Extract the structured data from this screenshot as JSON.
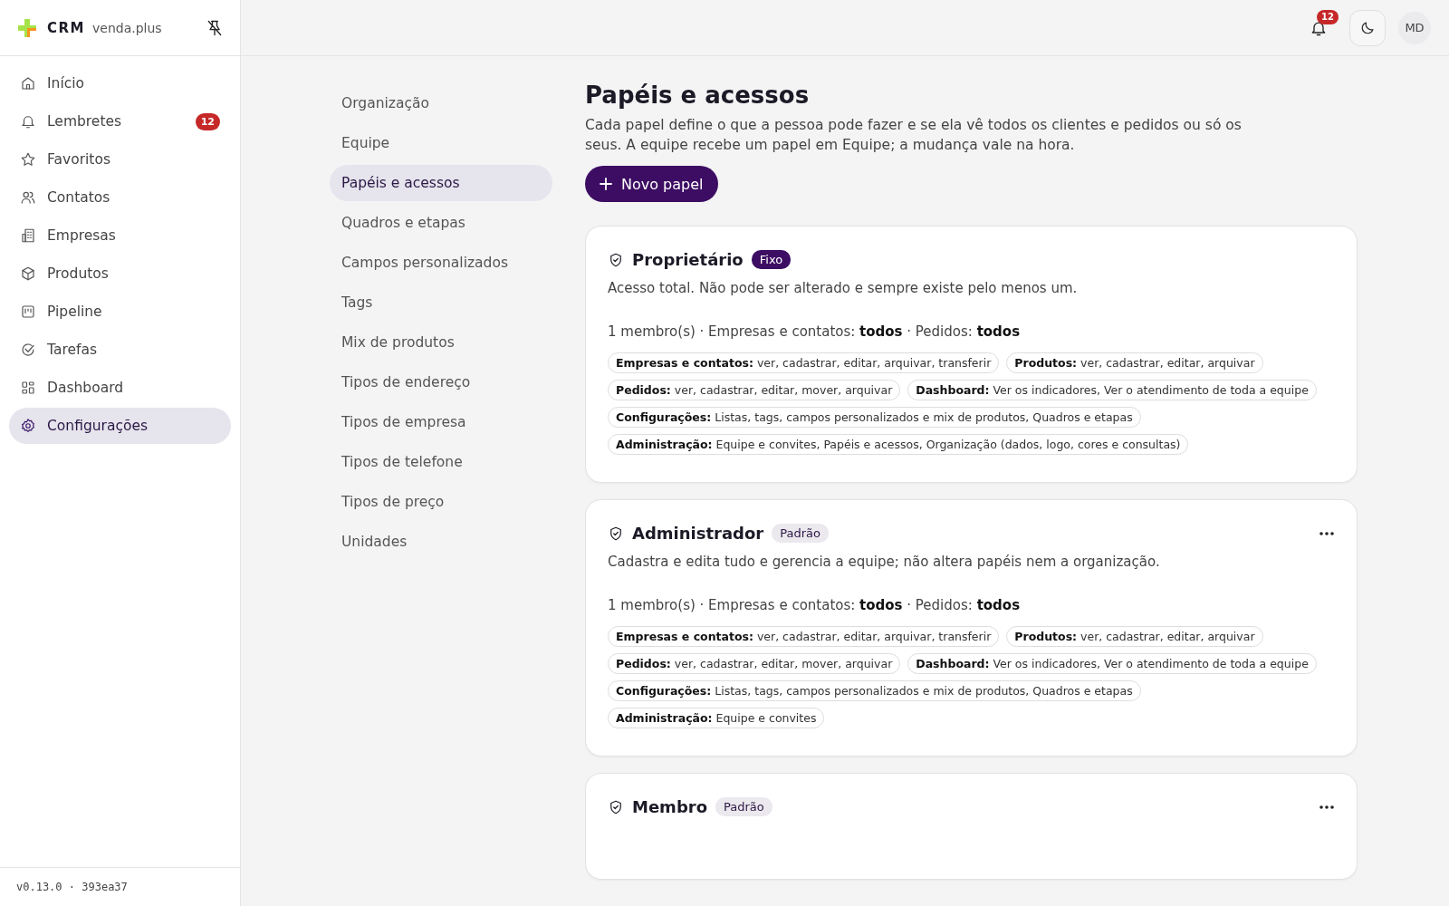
{
  "brand": {
    "name": "CRM",
    "domain": "venda.plus"
  },
  "sidebar": {
    "items": [
      {
        "label": "Início",
        "selected": false
      },
      {
        "label": "Lembretes",
        "selected": false,
        "badge": "12"
      },
      {
        "label": "Favoritos",
        "selected": false
      },
      {
        "label": "Contatos",
        "selected": false
      },
      {
        "label": "Empresas",
        "selected": false
      },
      {
        "label": "Produtos",
        "selected": false
      },
      {
        "label": "Pipeline",
        "selected": false
      },
      {
        "label": "Tarefas",
        "selected": false
      },
      {
        "label": "Dashboard",
        "selected": false
      },
      {
        "label": "Configurações",
        "selected": true
      }
    ],
    "version": "v0.13.0 · 393ea37"
  },
  "topbar": {
    "notifications": "12",
    "avatar": "MD"
  },
  "settings_nav": [
    {
      "label": "Organização",
      "selected": false
    },
    {
      "label": "Equipe",
      "selected": false
    },
    {
      "label": "Papéis e acessos",
      "selected": true
    },
    {
      "label": "Quadros e etapas",
      "selected": false
    },
    {
      "label": "Campos personalizados",
      "selected": false
    },
    {
      "label": "Tags",
      "selected": false
    },
    {
      "label": "Mix de produtos",
      "selected": false
    },
    {
      "label": "Tipos de endereço",
      "selected": false
    },
    {
      "label": "Tipos de empresa",
      "selected": false
    },
    {
      "label": "Tipos de telefone",
      "selected": false
    },
    {
      "label": "Tipos de preço",
      "selected": false
    },
    {
      "label": "Unidades",
      "selected": false
    }
  ],
  "page": {
    "title": "Papéis e acessos",
    "description": "Cada papel define o que a pessoa pode fazer e se ela vê todos os clientes e pedidos ou só os seus. A equipe recebe um papel em Equipe; a mudança vale na hora.",
    "new_button": "Novo papel"
  },
  "roles": [
    {
      "name": "Proprietário",
      "tag": {
        "label": "Fixo",
        "kind": "fixed"
      },
      "has_menu": false,
      "description": "Acesso total. Não pode ser alterado e sempre existe pelo menos um.",
      "summary": "1 membro(s) · Empresas e contatos: **todos** · Pedidos: **todos**",
      "permissions": [
        {
          "area": "Empresas e contatos:",
          "actions": "ver, cadastrar, editar, arquivar, transferir"
        },
        {
          "area": "Produtos:",
          "actions": "ver, cadastrar, editar, arquivar"
        },
        {
          "area": "Pedidos:",
          "actions": "ver, cadastrar, editar, mover, arquivar"
        },
        {
          "area": "Dashboard:",
          "actions": "Ver os indicadores, Ver o atendimento de toda a equipe"
        },
        {
          "area": "Configurações:",
          "actions": "Listas, tags, campos personalizados e mix de produtos, Quadros e etapas"
        },
        {
          "area": "Administração:",
          "actions": "Equipe e convites, Papéis e acessos, Organização (dados, logo, cores e consultas)"
        }
      ]
    },
    {
      "name": "Administrador",
      "tag": {
        "label": "Padrão",
        "kind": "default"
      },
      "has_menu": true,
      "description": "Cadastra e edita tudo e gerencia a equipe; não altera papéis nem a organização.",
      "summary": "1 membro(s) · Empresas e contatos: **todos** · Pedidos: **todos**",
      "permissions": [
        {
          "area": "Empresas e contatos:",
          "actions": "ver, cadastrar, editar, arquivar, transferir"
        },
        {
          "area": "Produtos:",
          "actions": "ver, cadastrar, editar, arquivar"
        },
        {
          "area": "Pedidos:",
          "actions": "ver, cadastrar, editar, mover, arquivar"
        },
        {
          "area": "Dashboard:",
          "actions": "Ver os indicadores, Ver o atendimento de toda a equipe"
        },
        {
          "area": "Configurações:",
          "actions": "Listas, tags, campos personalizados e mix de produtos, Quadros e etapas"
        },
        {
          "area": "Administração:",
          "actions": "Equipe e convites"
        }
      ]
    },
    {
      "name": "Membro",
      "tag": {
        "label": "Padrão",
        "kind": "default"
      },
      "has_menu": true
    }
  ]
}
